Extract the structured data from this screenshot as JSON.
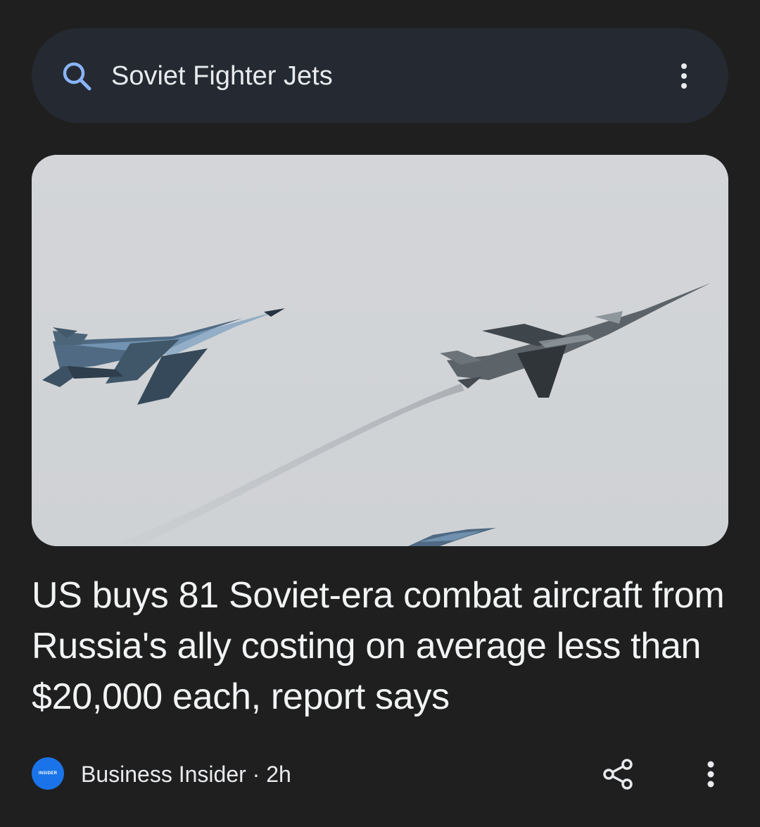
{
  "search": {
    "query": "Soviet Fighter Jets",
    "icon": "search-icon",
    "menu_icon": "more-vertical-icon"
  },
  "article": {
    "image_alt": "Fighter jets flying in formation",
    "headline": "US buys 81 Soviet-era combat aircraft from Russia's ally costing on average less than $20,000 each, report says",
    "source": {
      "logo_text": "INSIDER",
      "name": "Business Insider",
      "separator": " · ",
      "age": "2h"
    },
    "share_icon": "share-icon",
    "more_icon": "more-vertical-icon"
  },
  "colors": {
    "background": "#1f1f1f",
    "search_bar": "#252932",
    "accent_blue": "#8ab4f8",
    "logo_blue": "#1a73e8",
    "text_primary": "#f1f3f4"
  }
}
